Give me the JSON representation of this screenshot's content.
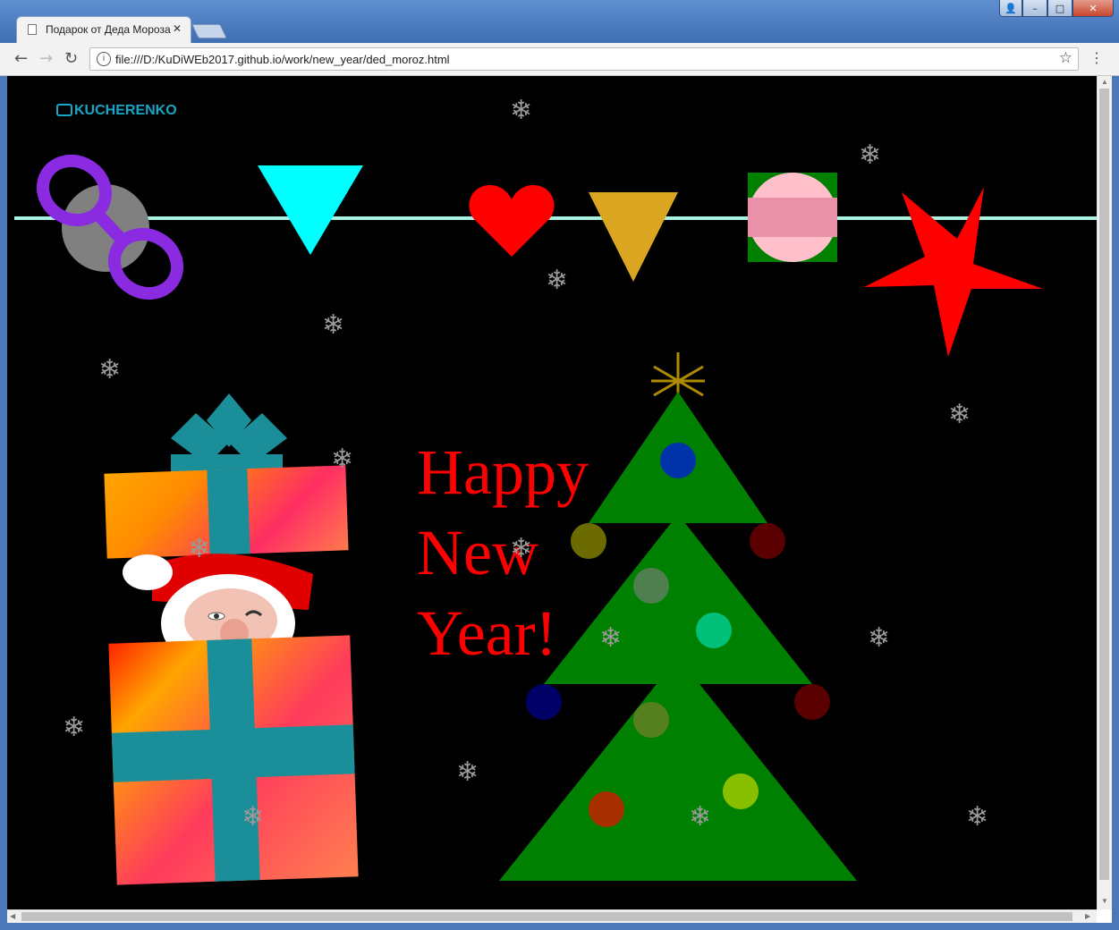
{
  "window": {
    "tab_title": "Подарок от Деда Мороза",
    "tab_close": "✕",
    "url": "file:///D:/KuDiWEb2017.github.io/work/new_year/ded_moroz.html",
    "controls": {
      "user": "👤",
      "minimize": "–",
      "maximize": "□",
      "close": "✕"
    },
    "nav": {
      "back": "←",
      "forward": "→",
      "reload": "↻",
      "info": "i",
      "bookmark": "☆",
      "menu": "⋮"
    }
  },
  "page": {
    "logo": "KUCHERENKO",
    "greeting": {
      "line1": "Happy",
      "line2": "New",
      "line3": "Year!"
    },
    "snowflake": "❄",
    "colors": {
      "background": "#000000",
      "garland": "#a8f0e0",
      "tree": "#008000",
      "heart": "#ff0000",
      "cyan_triangle": "#00ffff",
      "gold_triangle": "#daa520",
      "star": "#ff0000",
      "ribbon": "#1a8f99",
      "infinity": "#8a2be2"
    },
    "decorations": [
      "infinity-ornament",
      "cyan-triangle",
      "heart",
      "gold-triangle",
      "pink-ball-ornament",
      "red-star"
    ],
    "tree_balls": [
      "#0033aa",
      "#6b6b00",
      "#5a0000",
      "#4f7f4f",
      "#00c07a",
      "#000066",
      "#5a0000",
      "#567f1f",
      "#a83000",
      "#88c000"
    ]
  }
}
